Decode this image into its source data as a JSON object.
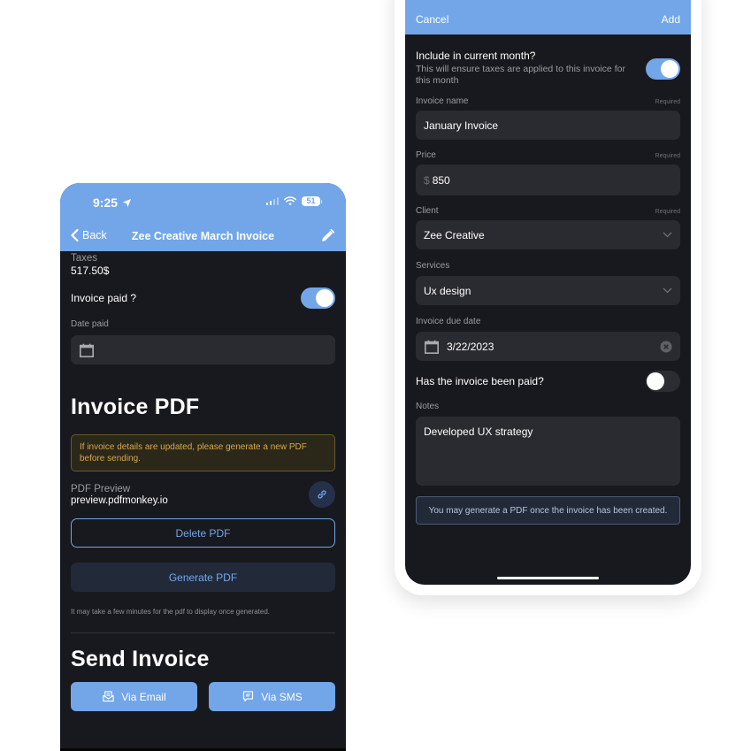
{
  "left_screen": {
    "status_bar": {
      "time": "9:25",
      "battery": "51",
      "location_icon": "location-arrow-icon",
      "signal_icon": "cellular-signal-icon",
      "wifi_icon": "wifi-icon"
    },
    "nav": {
      "back_label": "Back",
      "title": "Zee Creative March Invoice",
      "edit_icon": "pencil-icon"
    },
    "taxes": {
      "label": "Taxes",
      "value": "517.50$"
    },
    "invoice_paid": {
      "label": "Invoice paid ?",
      "on": true
    },
    "date_paid": {
      "label": "Date paid",
      "value": ""
    },
    "pdf_section": {
      "title": "Invoice PDF",
      "warning": "If invoice details are updated, please generate a new PDF before sending.",
      "preview_label": "PDF Preview",
      "preview_value": "preview.pdfmonkey.io",
      "delete_label": "Delete PDF",
      "generate_label": "Generate PDF",
      "hint": "It may take a few minutes for the pdf to display once generated."
    },
    "send_section": {
      "title": "Send Invoice",
      "email_label": "Via Email",
      "sms_label": "Via SMS"
    },
    "colors": {
      "accent": "#72a6e8",
      "background": "#18191e",
      "field": "#2a2b31",
      "warning": "#d7a94b"
    }
  },
  "right_screen": {
    "header": {
      "cancel_label": "Cancel",
      "add_label": "Add"
    },
    "include_month": {
      "label": "Include in current month?",
      "description": "This will ensure taxes are applied to this invoice for this month",
      "on": true
    },
    "required_label": "Required",
    "invoice_name": {
      "label": "Invoice name",
      "value": "January Invoice"
    },
    "price": {
      "label": "Price",
      "currency": "$",
      "value": "850"
    },
    "client": {
      "label": "Client",
      "value": "Zee Creative"
    },
    "services": {
      "label": "Services",
      "value": "Ux design"
    },
    "due_date": {
      "label": "Invoice due date",
      "value": "3/22/2023"
    },
    "paid": {
      "label": "Has the invoice been paid?",
      "on": false
    },
    "notes": {
      "label": "Notes",
      "value": "Developed UX strategy"
    },
    "info": "You may generate a PDF once the invoice has been created."
  }
}
